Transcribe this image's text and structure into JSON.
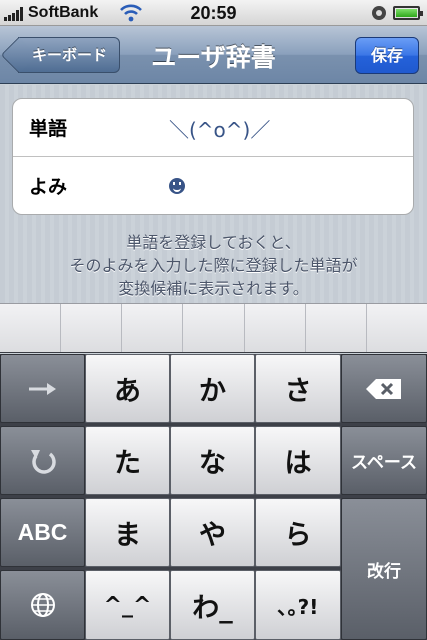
{
  "status_bar": {
    "carrier": "SoftBank",
    "time": "20:59"
  },
  "nav": {
    "back_label": "キーボード",
    "title": "ユーザ辞書",
    "save_label": "保存"
  },
  "form": {
    "word_label": "単語",
    "word_value": "＼(^o^)／",
    "reading_label": "よみ",
    "reading_value": ""
  },
  "help_text": {
    "line1": "単語を登録しておくと、",
    "line2": "そのよみを入力した際に登録した単語が",
    "line3": "変換候補に表示されます。"
  },
  "keyboard": {
    "row1": [
      "あ",
      "か",
      "さ"
    ],
    "row2": [
      "た",
      "な",
      "は"
    ],
    "row3": [
      "ま",
      "や",
      "ら"
    ],
    "row4": [
      "^_^",
      "わ_",
      "､｡?!"
    ],
    "abc_label": "ABC",
    "space_label": "スペース",
    "return_label": "改行"
  },
  "colors": {
    "nav_bar": "#7a91ae",
    "save_button": "#2562da",
    "field_value": "#385487",
    "keyboard_bg": "#3d4048"
  },
  "icons": [
    "signal-icon",
    "wifi-icon",
    "lock-rotation-icon",
    "battery-icon",
    "smiley-icon",
    "arrow-right-icon",
    "undo-icon",
    "globe-icon",
    "delete-icon"
  ]
}
